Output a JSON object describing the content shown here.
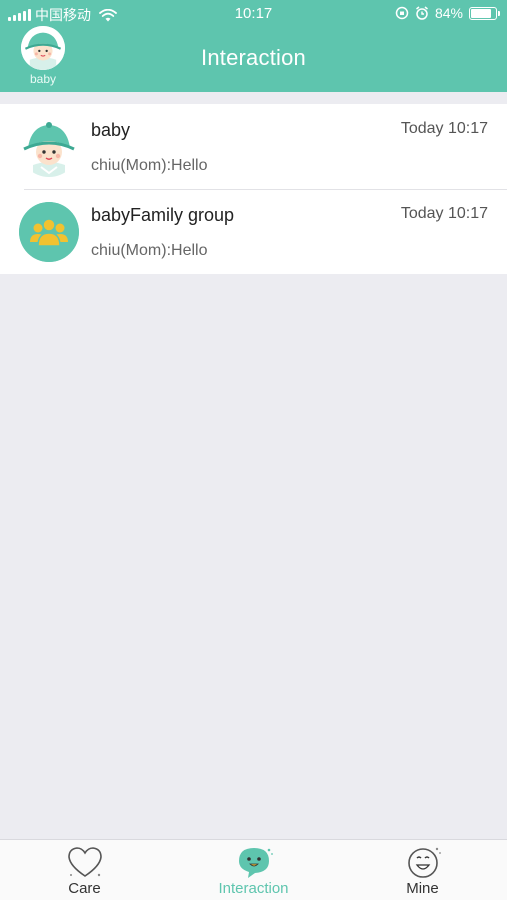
{
  "status_bar": {
    "carrier": "中国移动",
    "time": "10:17",
    "battery": "84%",
    "battery_level": 0.84
  },
  "header": {
    "title": "Interaction",
    "profile_name": "baby"
  },
  "conversations": [
    {
      "title": "baby",
      "time": "Today 10:17",
      "preview": "chiu(Mom):Hello",
      "avatar_icon": "baby-avatar-icon"
    },
    {
      "title": "babyFamily group",
      "time": "Today 10:17",
      "preview": "chiu(Mom):Hello",
      "avatar_icon": "family-group-icon"
    }
  ],
  "tabs": [
    {
      "label": "Care",
      "icon": "heart-icon",
      "active": false
    },
    {
      "label": "Interaction",
      "icon": "chat-bubble-icon",
      "active": true
    },
    {
      "label": "Mine",
      "icon": "smiley-icon",
      "active": false
    }
  ],
  "colors": {
    "accent": "#5ec5ae",
    "background": "#ececf1",
    "group_icon": "#f2c230"
  }
}
